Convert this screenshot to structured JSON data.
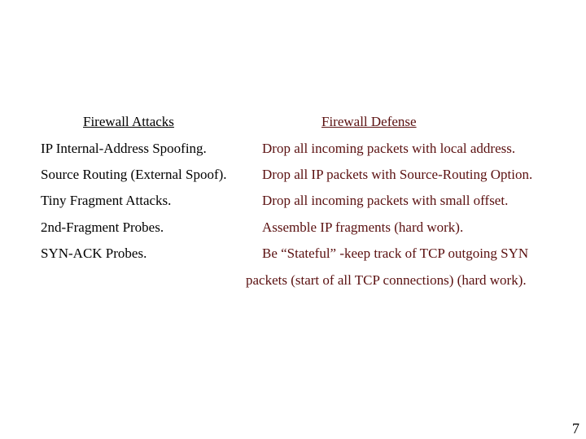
{
  "columns": {
    "attacks_header": "Firewall Attacks",
    "defense_header": "Firewall Defense"
  },
  "rows": [
    {
      "attack": "IP Internal-Address Spoofing.",
      "defense": "Drop all incoming packets with local address."
    },
    {
      "attack": "Source Routing (External Spoof).",
      "defense": "Drop all IP packets with Source-Routing Option."
    },
    {
      "attack": "Tiny Fragment Attacks.",
      "defense": "Drop all incoming packets with small offset."
    },
    {
      "attack": "2nd-Fragment Probes.",
      "defense": "Assemble IP fragments (hard work)."
    },
    {
      "attack": "SYN-ACK Probes.",
      "defense": "Be “Stateful” -keep track of TCP outgoing SYN"
    }
  ],
  "continuation": "packets (start of all TCP connections) (hard work).",
  "page_number": "7",
  "colors": {
    "left_text": "#000000",
    "right_text": "#5a1010"
  }
}
